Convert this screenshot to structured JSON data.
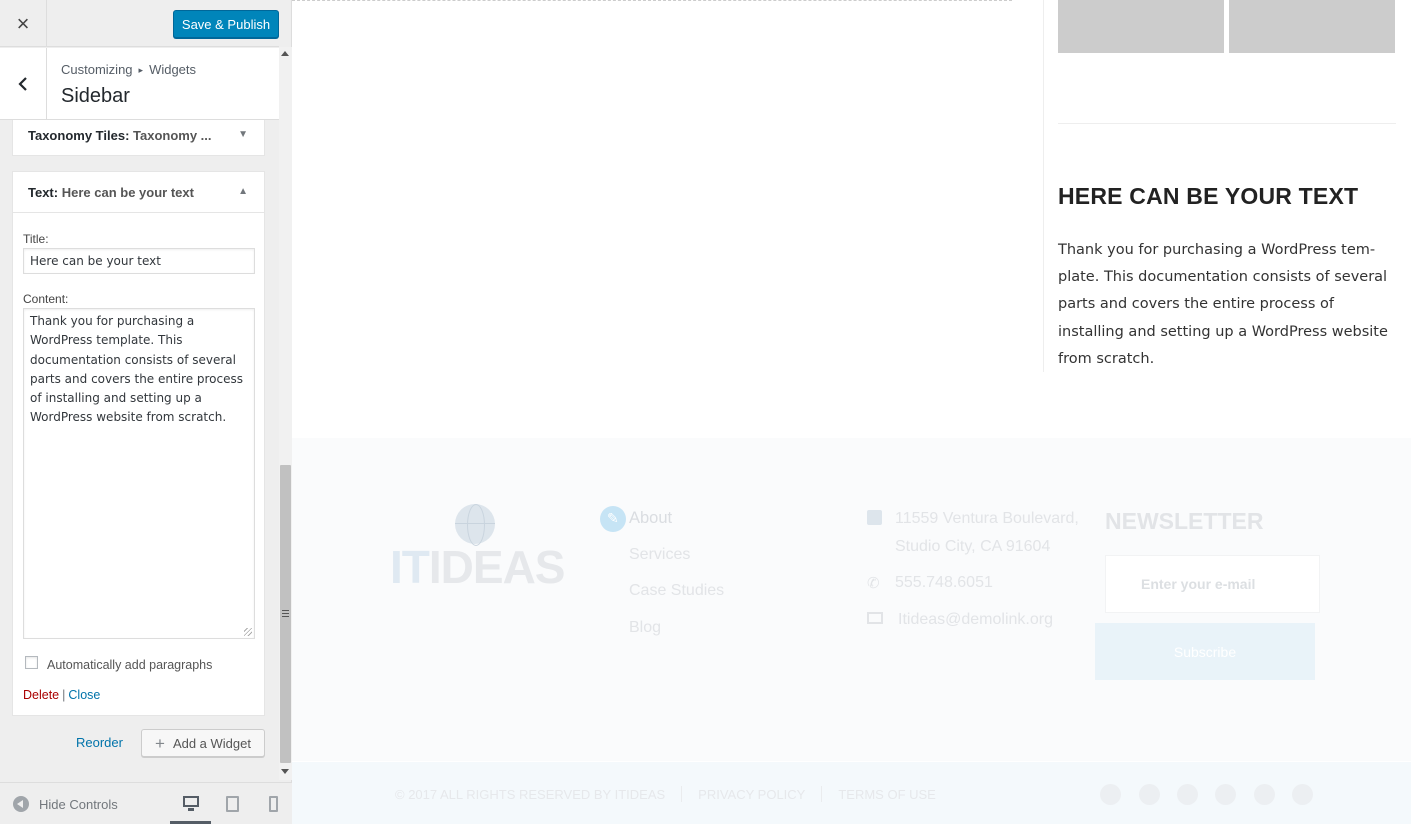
{
  "customizer": {
    "close_symbol": "×",
    "publish_label": "Save & Publish",
    "breadcrumb_root": "Customizing",
    "breadcrumb_sep": "▸",
    "breadcrumb_current": "Widgets",
    "section_title": "Sidebar",
    "widgets": [
      {
        "type": "Taxonomy Tiles",
        "title_suffix": "Taxonomy ...",
        "state": "collapsed"
      },
      {
        "type": "Text",
        "title_suffix": "Here can be your text",
        "state": "expanded"
      }
    ],
    "text_widget": {
      "title_label": "Title:",
      "title_value": "Here can be your text",
      "content_label": "Content:",
      "content_value": "Thank you for purchasing a WordPress template. This documentation consists of several parts and covers the entire process of installing and setting up a WordPress website from scratch.",
      "auto_paragraphs_label": "Automatically add paragraphs",
      "auto_paragraphs_checked": false,
      "delete_label": "Delete",
      "separator": "|",
      "close_label": "Close"
    },
    "reorder_label": "Reorder",
    "add_widget_label": "Add a Widget",
    "hide_controls_label": "Hide Controls",
    "devices": [
      "desktop-icon",
      "tablet-icon",
      "mobile-icon"
    ],
    "active_device": "desktop",
    "accent_color": "#0085ba"
  },
  "preview": {
    "sidebar_widget": {
      "heading": "HERE CAN BE YOUR TEXT",
      "body": "Thank you for purchasing a WordPress tem-plate. This documentation consists of several parts and covers the entire process of installing and setting up a WordPress website from scratch."
    },
    "footer": {
      "logo_it": "IT",
      "logo_ideas": "IDEAS",
      "nav": [
        "About",
        "Services",
        "Case Studies",
        "Blog"
      ],
      "address": "11559 Ventura Boulevard, Studio City, CA 91604",
      "phone": "555.748.6051",
      "email": "Itideas@demolink.org",
      "newsletter_heading": "NEWSLETTER",
      "email_placeholder": "Enter your e-mail",
      "subscribe_label": "Subscribe"
    },
    "bottom": {
      "copyright": "© 2017 ALL RIGHTS RESERVED BY ITIDEAS",
      "privacy": "PRIVACY POLICY",
      "terms": "TERMS OF USE",
      "social_icons": [
        "facebook-icon",
        "twitter-icon",
        "google-plus-icon",
        "vimeo-icon",
        "youtube-icon",
        "rss-icon"
      ]
    }
  }
}
